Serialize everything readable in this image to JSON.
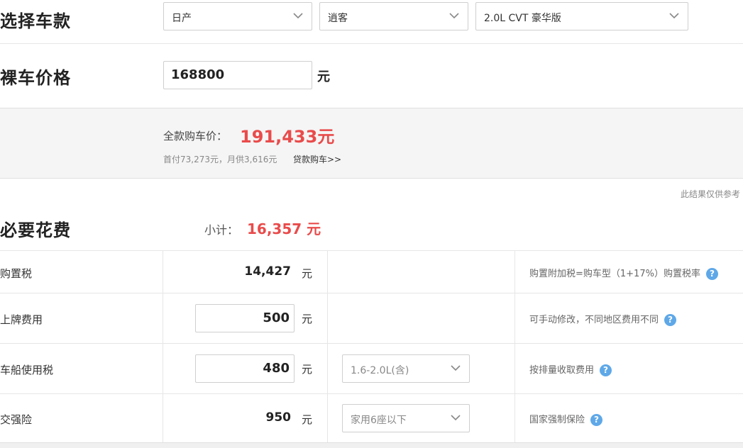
{
  "select_car": {
    "title": "选择车款",
    "brand": "日产",
    "series": "逍客",
    "model": "2.0L CVT 豪华版"
  },
  "bare_price": {
    "title": "裸车价格",
    "value": "168800",
    "unit": "元"
  },
  "summary": {
    "full_label": "全款购车价：",
    "full_value": "191,433元",
    "sub_info": "首付73,273元，月供3,616元",
    "loan_link": "贷款购车>>"
  },
  "note": "此结果仅供参考",
  "required": {
    "title": "必要花费",
    "subtotal_label": "小计：",
    "subtotal_value": "16,357 元",
    "rows": [
      {
        "label": "购置税",
        "value": "14,427",
        "unit": "元",
        "desc": "购置附加税=购车型（1+17%）购置税率"
      },
      {
        "label": "上牌费用",
        "value": "500",
        "unit": "元",
        "desc": "可手动修改，不同地区费用不同"
      },
      {
        "label": "车船使用税",
        "value": "480",
        "unit": "元",
        "option": "1.6-2.0L(含)",
        "desc": "按排量收取费用"
      },
      {
        "label": "交强险",
        "value": "950",
        "unit": "元",
        "option": "家用6座以下",
        "desc": "国家强制保险"
      }
    ]
  },
  "help_glyph": "?",
  "icons": {
    "dropdown": "chevron-down-icon",
    "help": "question-circle-icon"
  },
  "colors": {
    "accent_red": "#e94b4b",
    "help_blue": "#5fa8e8"
  }
}
